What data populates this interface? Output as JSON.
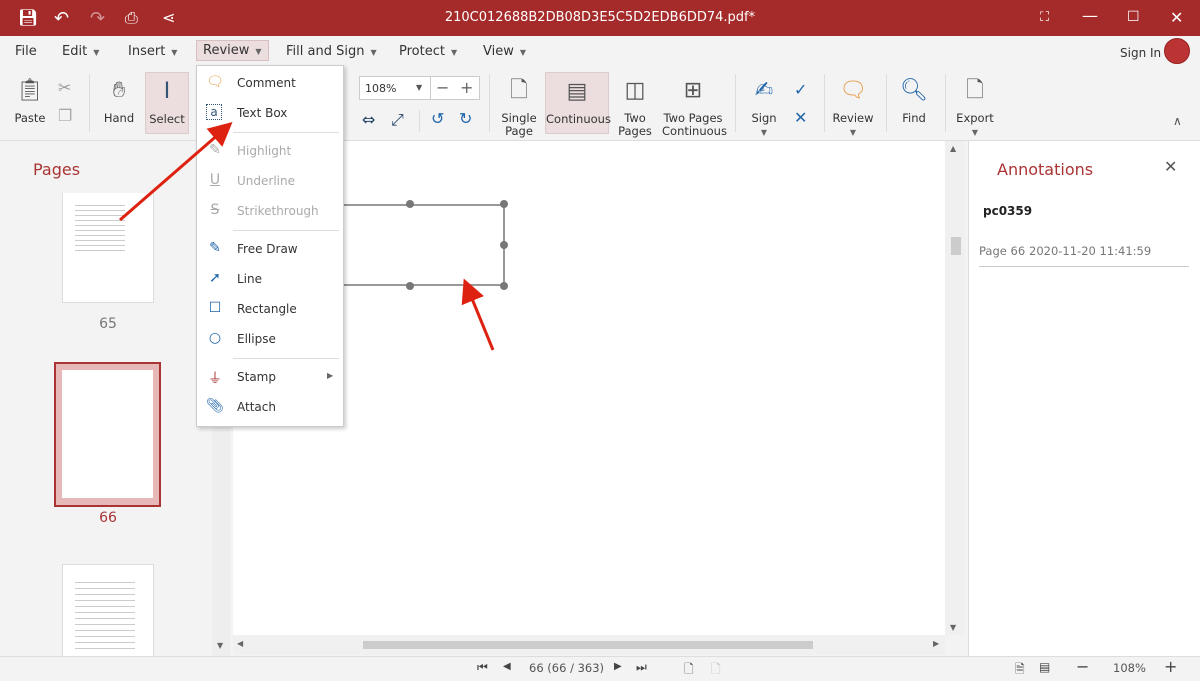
{
  "window": {
    "title": "210C012688B2DB08D3E5C5D2EDB6DD74.pdf*",
    "accent": "#a52a2a"
  },
  "menubar": {
    "items": [
      "File",
      "Edit",
      "Insert",
      "Review",
      "Fill and Sign",
      "Protect",
      "View"
    ],
    "sign_in": "Sign In"
  },
  "ribbon": {
    "paste": "Paste",
    "hand": "Hand",
    "select": "Select",
    "zoom": "108%",
    "single_page": [
      "Single",
      "Page"
    ],
    "continuous": "Continuous",
    "two_pages": [
      "Two",
      "Pages"
    ],
    "two_pages_continuous": [
      "Two Pages",
      "Continuous"
    ],
    "sign": "Sign",
    "review": "Review",
    "find": "Find",
    "export": "Export"
  },
  "review_menu": {
    "items": [
      {
        "label": "Comment",
        "icon": "comment-icon",
        "enabled": true
      },
      {
        "label": "Text Box",
        "icon": "textbox-icon",
        "enabled": true
      },
      {
        "label": "Highlight",
        "icon": "highlight-icon",
        "enabled": false
      },
      {
        "label": "Underline",
        "icon": "underline-icon",
        "enabled": false
      },
      {
        "label": "Strikethrough",
        "icon": "strikethrough-icon",
        "enabled": false
      },
      {
        "label": "Free Draw",
        "icon": "pen-icon",
        "enabled": true
      },
      {
        "label": "Line",
        "icon": "line-icon",
        "enabled": true
      },
      {
        "label": "Rectangle",
        "icon": "rectangle-icon",
        "enabled": true
      },
      {
        "label": "Ellipse",
        "icon": "ellipse-icon",
        "enabled": true
      },
      {
        "label": "Stamp",
        "icon": "stamp-icon",
        "enabled": true
      },
      {
        "label": "Attach",
        "icon": "paperclip-icon",
        "enabled": true
      }
    ]
  },
  "pages_panel": {
    "title": "Pages",
    "thumbs": [
      "65",
      "66",
      ""
    ]
  },
  "annotations": {
    "title": "Annotations",
    "items": [
      {
        "author": "pc0359",
        "page": "Page 66",
        "time": "2020-11-20 11:41:59"
      }
    ]
  },
  "status": {
    "page": "66 (66 / 363)",
    "zoom": "108%"
  }
}
